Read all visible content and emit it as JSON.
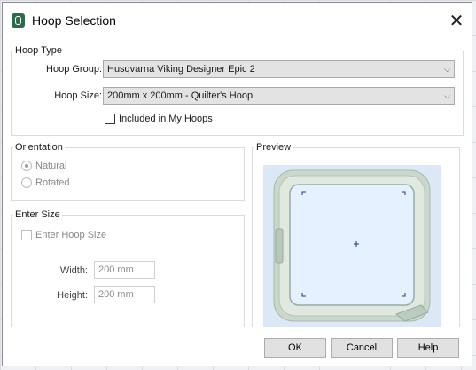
{
  "window": {
    "title": "Hoop Selection",
    "close_symbol": "✕"
  },
  "hoop_type": {
    "legend": "Hoop Type",
    "group_label": "Hoop Group:",
    "group_value": "Husqvarna Viking Designer Epic 2",
    "size_label": "Hoop Size:",
    "size_value": "200mm x 200mm - Quilter's Hoop",
    "included_label": "Included in My Hoops",
    "included_checked": false
  },
  "orientation": {
    "legend": "Orientation",
    "options": [
      {
        "label": "Natural",
        "checked": true
      },
      {
        "label": "Rotated",
        "checked": false
      }
    ]
  },
  "enter_size": {
    "legend": "Enter Hoop Size",
    "group_legend": "Enter Size",
    "checkbox_label": "Enter Hoop Size",
    "width_label": "Width:",
    "width_value": "200 mm",
    "height_label": "Height:",
    "height_value": "200 mm"
  },
  "preview": {
    "legend": "Preview"
  },
  "buttons": {
    "ok": "OK",
    "cancel": "Cancel",
    "help": "Help"
  },
  "colors": {
    "preview_bg": "#dde8f6",
    "hoop_frame": "#c4d3c6",
    "hoop_inner": "#e6f1ff",
    "marker": "#1f3a7a"
  }
}
